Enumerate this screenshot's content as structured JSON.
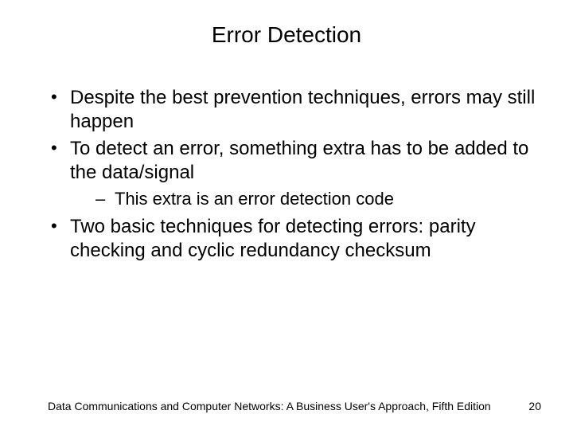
{
  "title": "Error Detection",
  "bullets": {
    "b1": "Despite the best prevention techniques, errors may still happen",
    "b2": "To detect an error, something extra has to be added to the data/signal",
    "b2_sub1": "This extra is an error detection code",
    "b3": "Two basic techniques for detecting errors: parity checking and cyclic redundancy checksum"
  },
  "footer": {
    "text": "Data Communications and Computer Networks: A Business User's Approach, Fifth Edition",
    "page": "20"
  }
}
